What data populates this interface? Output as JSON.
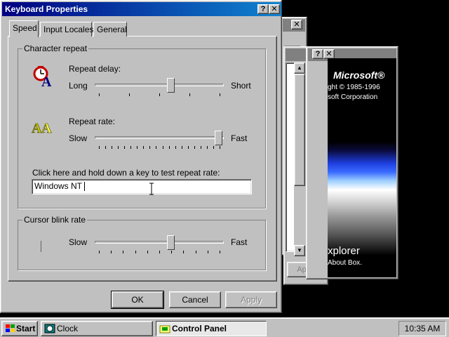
{
  "dialog": {
    "title": "Keyboard Properties",
    "help_button": "?",
    "close_button": "✕",
    "tabs": [
      {
        "label": "Speed",
        "active": true
      },
      {
        "label": "Input Locales",
        "active": false
      },
      {
        "label": "General",
        "active": false
      }
    ],
    "character_repeat": {
      "group_label": "Character repeat",
      "repeat_delay": {
        "label": "Repeat delay:",
        "min_label": "Long",
        "max_label": "Short",
        "value_fraction": 0.6
      },
      "repeat_rate": {
        "label": "Repeat rate:",
        "min_label": "Slow",
        "max_label": "Fast",
        "value_fraction": 1.0
      },
      "test_prompt": "Click here and hold down a key to test repeat rate:",
      "test_value": "Windows NT "
    },
    "cursor_blink": {
      "group_label": "Cursor blink rate",
      "min_label": "Slow",
      "max_label": "Fast",
      "value_fraction": 0.6
    },
    "buttons": {
      "ok": "OK",
      "cancel": "Cancel",
      "apply": "Apply"
    }
  },
  "background_windows": {
    "apply_label": "Apply",
    "splash": {
      "brand": "Microsoft®",
      "copyright": "ght © 1985-1996",
      "corporation": "soft Corporation",
      "app_name": "xplorer",
      "about": "About Box."
    }
  },
  "taskbar": {
    "start_label": "Start",
    "tasks": [
      {
        "label": "Clock",
        "active": false
      },
      {
        "label": "Control Panel",
        "active": true
      }
    ],
    "clock": "10:35 AM"
  },
  "colors": {
    "title_active": "#000080",
    "title_active_end": "#1084d0",
    "face": "#c0c0c0",
    "desktop": "#000000"
  }
}
